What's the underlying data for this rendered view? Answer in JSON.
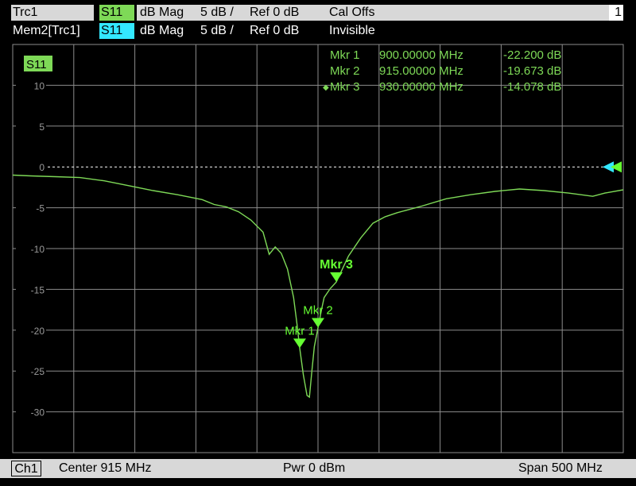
{
  "header": {
    "row1": {
      "trace": "Trc1",
      "param": "S11",
      "format": "dB Mag",
      "scale": "5 dB /",
      "ref": "Ref 0 dB",
      "status": "Cal Offs",
      "channel_number": "1"
    },
    "row2": {
      "trace": "Mem2[Trc1]",
      "param": "S11",
      "format": "dB Mag",
      "scale": "5 dB /",
      "ref": "Ref 0 dB",
      "status": "Invisible"
    }
  },
  "trace_label": "S11",
  "marker_table": [
    {
      "name": "Mkr 1",
      "freq": "900.00000 MHz",
      "value": "-22.200 dB",
      "active": false
    },
    {
      "name": "Mkr 2",
      "freq": "915.00000 MHz",
      "value": "-19.673 dB",
      "active": false
    },
    {
      "name": "Mkr 3",
      "freq": "930.00000 MHz",
      "value": "-14.078 dB",
      "active": true
    }
  ],
  "bottom_bar": {
    "channel": "Ch1",
    "center": "Center  915 MHz",
    "power": "Pwr  0 dBm",
    "span": "Span  500 MHz"
  },
  "colors": {
    "trace": "#7ed957",
    "marker": "#66ff33",
    "memory": "#33e8ff",
    "grid": "#8c8c8c",
    "background": "#000000"
  },
  "chart_data": {
    "type": "line",
    "xlim": [
      665,
      1165
    ],
    "ylim": [
      -35,
      15
    ],
    "ytick_values": [
      10,
      5,
      0,
      -5,
      -10,
      -15,
      -20,
      -25,
      -30
    ],
    "ytick_labels": [
      "10",
      "5",
      "0",
      "-5",
      "-10",
      "-15",
      "-20",
      "-25",
      "-30"
    ],
    "reference_level": 0,
    "grid": true,
    "series": [
      {
        "x": [
          665,
          680,
          700,
          720,
          740,
          760,
          780,
          800,
          820,
          830,
          840,
          850,
          860,
          870,
          875,
          880,
          885,
          890,
          895,
          898,
          900,
          903,
          906,
          908,
          910,
          912,
          915,
          918,
          920,
          925,
          930,
          935,
          940,
          950,
          960,
          970,
          980,
          1000,
          1020,
          1040,
          1060,
          1080,
          1100,
          1120,
          1140,
          1150,
          1165
        ],
        "y": [
          -1.0,
          -1.1,
          -1.2,
          -1.3,
          -1.7,
          -2.3,
          -2.9,
          -3.4,
          -4.0,
          -4.6,
          -4.9,
          -5.5,
          -6.5,
          -8.0,
          -10.7,
          -9.8,
          -10.6,
          -12.5,
          -16.0,
          -19.5,
          -22.2,
          -25.5,
          -28.0,
          -28.2,
          -25.0,
          -22.0,
          -19.7,
          -17.4,
          -16.0,
          -14.9,
          -14.1,
          -12.5,
          -10.9,
          -8.7,
          -6.9,
          -6.1,
          -5.6,
          -4.8,
          -3.9,
          -3.4,
          -3.0,
          -2.7,
          -2.9,
          -3.2,
          -3.6,
          -3.2,
          -2.8
        ]
      }
    ],
    "markers": [
      {
        "label": "Mkr 1",
        "x": 900,
        "y": -22.2
      },
      {
        "label": "Mkr 2",
        "x": 915,
        "y": -19.673
      },
      {
        "label": "Mkr 3",
        "x": 930,
        "y": -14.078
      }
    ]
  }
}
